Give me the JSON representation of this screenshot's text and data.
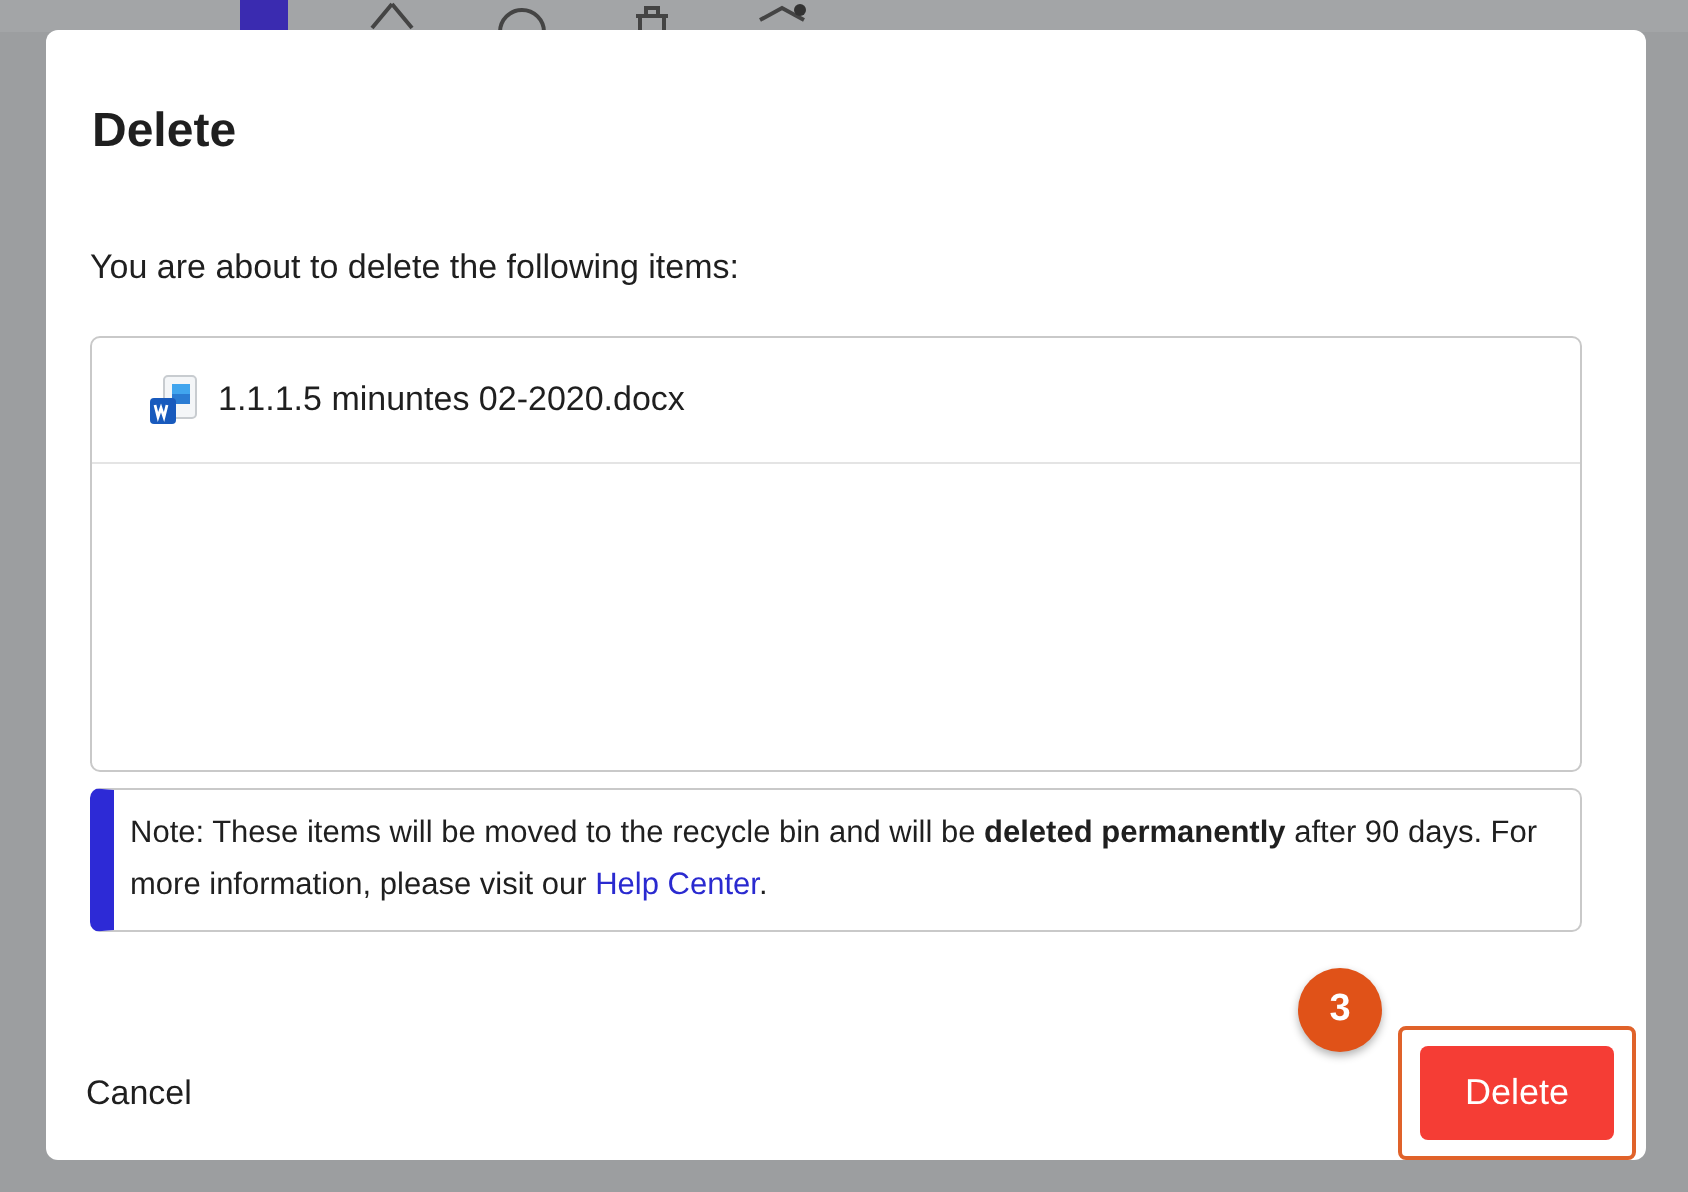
{
  "dialog": {
    "title": "Delete",
    "message": "You are about to delete the following items:",
    "items": [
      {
        "name": "1.1.1.5 minuntes 02-2020.docx",
        "kind": "word"
      }
    ],
    "note": {
      "text": "Note: These items will be moved to the recycle bin and will be **deleted permanently** after 90 days. For more information, please visit our ",
      "link": "Help Center",
      "after": "."
    },
    "buttons": [
      {
        "label": "Cancel",
        "kind": "text"
      },
      {
        "label": "Delete",
        "kind": "danger",
        "highlighted": true
      }
    ],
    "step_badge": "3"
  }
}
